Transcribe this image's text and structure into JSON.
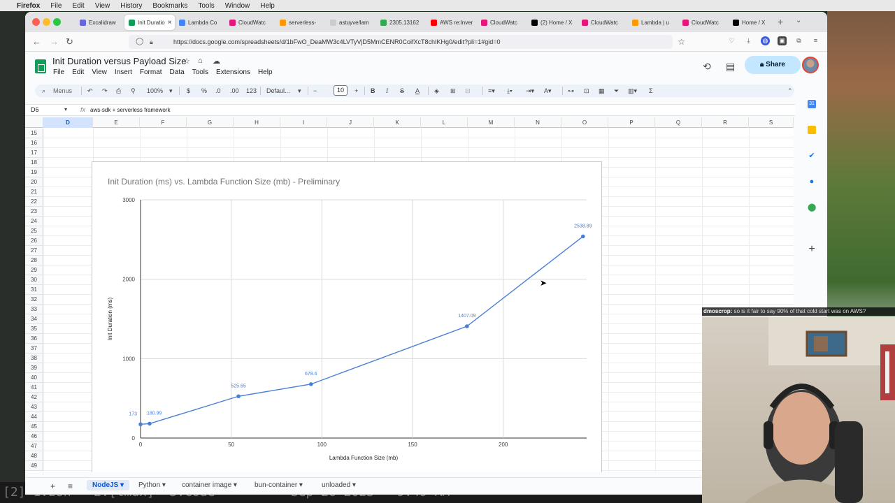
{
  "menubar": {
    "app": "Firefox",
    "items": [
      "File",
      "Edit",
      "View",
      "History",
      "Bookmarks",
      "Tools",
      "Window",
      "Help"
    ]
  },
  "tabs": [
    {
      "label": "Excalidraw",
      "color": "#6965db"
    },
    {
      "label": "Init Duratio",
      "color": "#0f9d58",
      "active": true
    },
    {
      "label": "Lambda Co",
      "color": "#4285f4"
    },
    {
      "label": "CloudWatc",
      "color": "#e7157b"
    },
    {
      "label": "serverless-",
      "color": "#ff9900"
    },
    {
      "label": "astuyve/lam",
      "color": "#cccccc"
    },
    {
      "label": "2305.13162",
      "color": "#34a853"
    },
    {
      "label": "AWS re:Inver",
      "color": "#ff0000"
    },
    {
      "label": "CloudWatc",
      "color": "#e7157b"
    },
    {
      "label": "(2) Home / X",
      "color": "#000000"
    },
    {
      "label": "CloudWatc",
      "color": "#e7157b"
    },
    {
      "label": "Lambda | u",
      "color": "#ff9900"
    },
    {
      "label": "CloudWatc",
      "color": "#e7157b"
    },
    {
      "label": "Home / X",
      "color": "#000000"
    }
  ],
  "url": "https://docs.google.com/spreadsheets/d/1bFwO_DeaMW3c4LVTyVjD5MmCENR0CoifXcT8chIKHg0/edit?pli=1#gid=0",
  "doc": {
    "title": "Init Duration versus Payload Size",
    "menus": [
      "File",
      "Edit",
      "View",
      "Insert",
      "Format",
      "Data",
      "Tools",
      "Extensions",
      "Help"
    ],
    "share": "Share"
  },
  "toolbar": {
    "search": "Menus",
    "zoom": "100%",
    "currency": "$",
    "percent": "%",
    "dec_less": ".0",
    "dec_more": ".00",
    "number_fmt": "123",
    "font": "Defaul...",
    "font_size": "10"
  },
  "formula": {
    "cell": "D6",
    "fx": "fx",
    "value": "aws-sdk + serverless framework"
  },
  "columns": [
    "D",
    "E",
    "F",
    "G",
    "H",
    "I",
    "J",
    "K",
    "L",
    "M",
    "N",
    "O",
    "P",
    "Q",
    "R",
    "S"
  ],
  "rows": [
    "15",
    "16",
    "17",
    "18",
    "19",
    "20",
    "21",
    "22",
    "23",
    "24",
    "25",
    "26",
    "27",
    "28",
    "29",
    "30",
    "31",
    "32",
    "33",
    "34",
    "35",
    "36",
    "37",
    "38",
    "39",
    "40",
    "41",
    "42",
    "43",
    "44",
    "45",
    "46",
    "47",
    "48",
    "49"
  ],
  "chart_data": {
    "type": "line",
    "title": "Init Duration (ms) vs. Lambda Function Size (mb) - Preliminary",
    "xlabel": "Lambda Function Size (mb)",
    "ylabel": "Init Duration (ms)",
    "xlim": [
      0,
      246
    ],
    "ylim": [
      0,
      3000
    ],
    "xticks": [
      "0",
      "50",
      "100",
      "150",
      "200"
    ],
    "yticks": [
      "0",
      "1000",
      "2000",
      "3000"
    ],
    "grid": true,
    "color": "#4a7fd6",
    "points": [
      {
        "x": 0,
        "y": 173,
        "label": "173"
      },
      {
        "x": 5,
        "y": 180.99,
        "label": "180.99"
      },
      {
        "x": 54,
        "y": 525.65,
        "label": "525.65"
      },
      {
        "x": 94,
        "y": 678.6,
        "label": "678.6"
      },
      {
        "x": 180,
        "y": 1407.09,
        "label": "1407.09"
      },
      {
        "x": 244,
        "y": 2538.89,
        "label": "2538.89"
      }
    ]
  },
  "sheet_tabs": {
    "tabs": [
      "NodeJS",
      "Python",
      "container image",
      "bun-container",
      "unloaded"
    ],
    "active": "NodeJS"
  },
  "chat": {
    "user": "dmoscrop:",
    "message": "so is it fair to say 90% of that cold start was on AWS?"
  },
  "terminal": "[2] 1:zsh-  2:[tmux]* 3:code          Sep 26 2023   9:49 AM"
}
